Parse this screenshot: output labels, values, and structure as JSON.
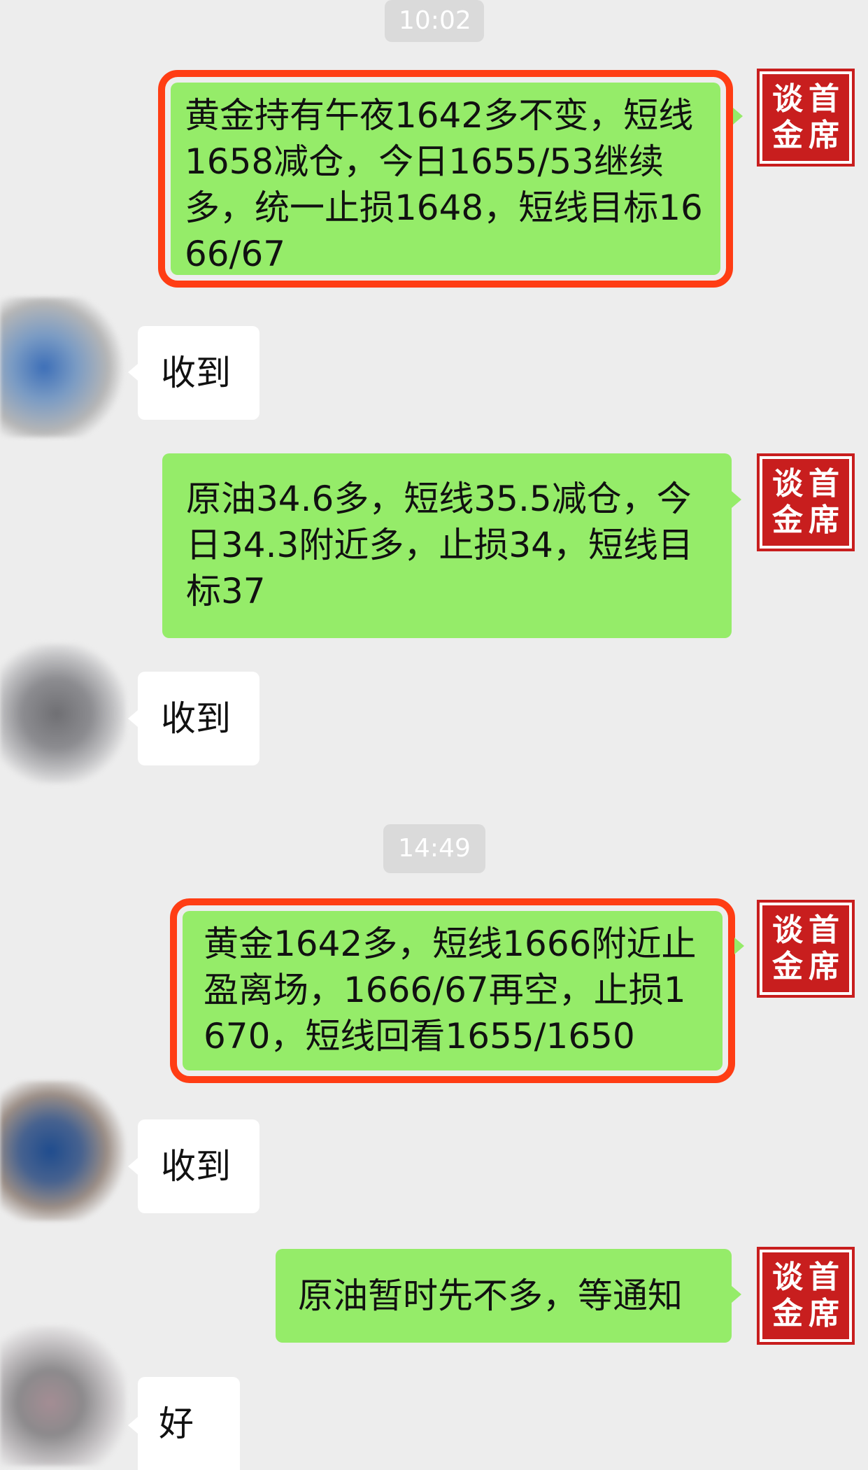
{
  "colors": {
    "background": "#ededed",
    "sent_bubble": "#95ec69",
    "received_bubble": "#ffffff",
    "highlight_border": "#ff3d14",
    "seal_red": "#c81e1e"
  },
  "sender_avatar": {
    "icon": "red-seal-avatar",
    "chars": [
      "谈",
      "首",
      "金",
      "席"
    ]
  },
  "timestamps": [
    "10:02",
    "14:49"
  ],
  "messages": [
    {
      "side": "right",
      "highlighted": true,
      "text": "黄金持有午夜1642多不变，短线1658减仓，今日1655/53继续多，统一止损1648，短线目标1666/67"
    },
    {
      "side": "left",
      "text": "收到"
    },
    {
      "side": "right",
      "highlighted": false,
      "text": "原油34.6多，短线35.5减仓，今日34.3附近多，止损34，短线目标37"
    },
    {
      "side": "left",
      "text": "收到"
    },
    {
      "side": "right",
      "highlighted": true,
      "text": "黄金1642多，短线1666附近止盈离场，1666/67再空，止损1670，短线回看1655/1650"
    },
    {
      "side": "left",
      "text": "收到"
    },
    {
      "side": "right",
      "highlighted": false,
      "text": "原油暂时先不多，等通知"
    },
    {
      "side": "left",
      "text": "好"
    }
  ]
}
